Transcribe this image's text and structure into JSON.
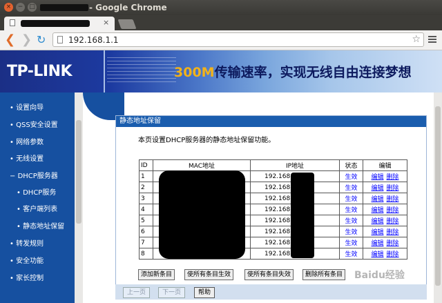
{
  "window": {
    "title": "- Google Chrome"
  },
  "browser": {
    "url": "192.168.1.1"
  },
  "banner": {
    "logo": "TP-LINK",
    "slogan_highlight": "300M",
    "slogan_rest": "传输速率，实现无线自由连接梦想"
  },
  "sidebar": {
    "items": [
      {
        "label": "设置向导",
        "bullet": "•"
      },
      {
        "label": "QSS安全设置",
        "bullet": "•"
      },
      {
        "label": "网络参数",
        "bullet": "•"
      },
      {
        "label": "无线设置",
        "bullet": "•"
      },
      {
        "label": "DHCP服务器",
        "bullet": "−"
      },
      {
        "label": "DHCP服务",
        "bullet": "•"
      },
      {
        "label": "客户端列表",
        "bullet": "•"
      },
      {
        "label": "静态地址保留",
        "bullet": "•"
      },
      {
        "label": "转发规则",
        "bullet": "•"
      },
      {
        "label": "安全功能",
        "bullet": "•"
      },
      {
        "label": "家长控制",
        "bullet": "•"
      }
    ]
  },
  "panel": {
    "title": "静态地址保留",
    "description": "本页设置DHCP服务器的静态地址保留功能。",
    "columns": {
      "id": "ID",
      "mac": "MAC地址",
      "ip": "IP地址",
      "status": "状态",
      "edit": "编辑"
    },
    "rows": [
      {
        "id": "1",
        "ip": "192.168",
        "status": "生效"
      },
      {
        "id": "2",
        "ip": "192.168",
        "status": "生效"
      },
      {
        "id": "3",
        "ip": "192.168",
        "status": "生效"
      },
      {
        "id": "4",
        "ip": "192.168",
        "status": "生效"
      },
      {
        "id": "5",
        "ip": "192.168",
        "status": "生效"
      },
      {
        "id": "6",
        "ip": "192.168",
        "status": "生效"
      },
      {
        "id": "7",
        "ip": "192.168",
        "status": "生效"
      },
      {
        "id": "8",
        "ip": "192.168",
        "status": "生效"
      }
    ],
    "edit_label": "编辑",
    "delete_label": "删除",
    "buttons": {
      "add": "添加新条目",
      "enable_all": "使所有条目生效",
      "disable_all": "使所有条目失效",
      "delete_all": "删除所有条目"
    },
    "nav": {
      "prev": "上一页",
      "next": "下一页",
      "help": "帮助"
    }
  },
  "watermark": "Baidu经验"
}
